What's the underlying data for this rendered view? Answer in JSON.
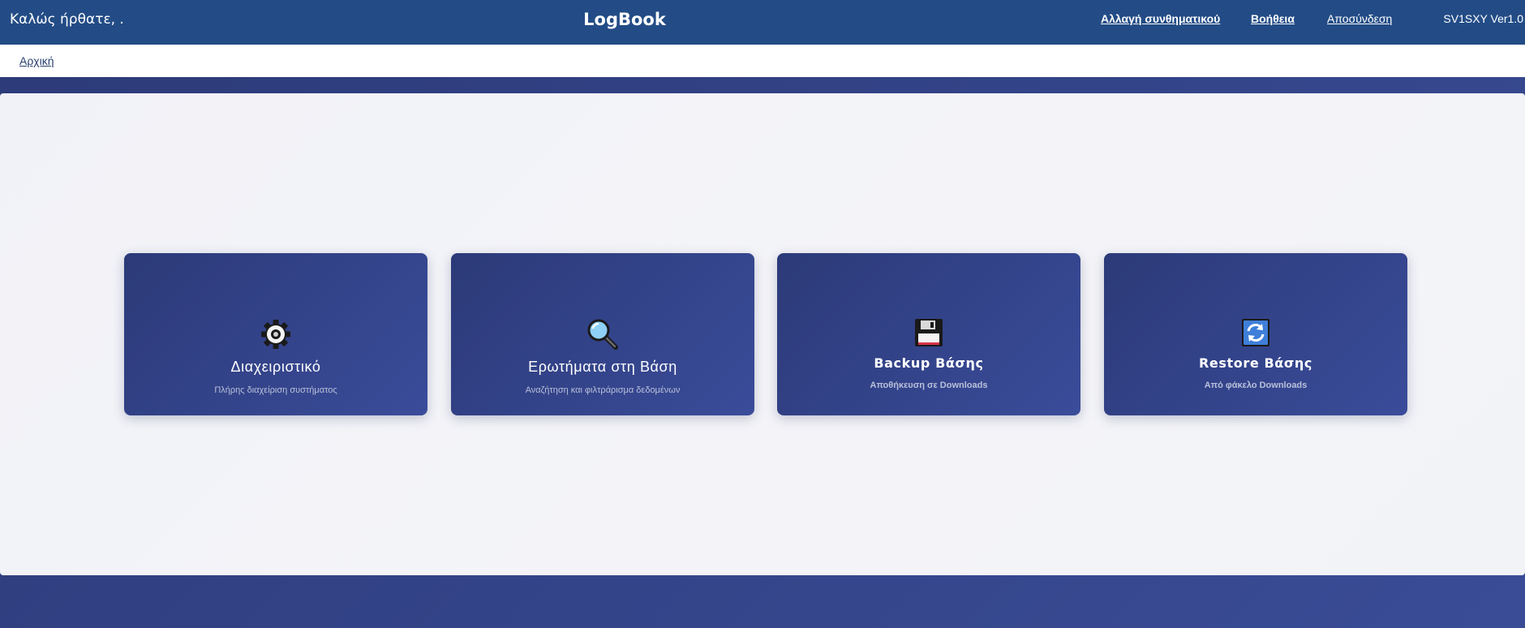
{
  "header": {
    "welcome": "Καλώς ήρθατε, .",
    "app_title": "LogBook",
    "links": {
      "change_password": "Αλλαγή συνθηματικού",
      "help": "Βοήθεια",
      "logout": "Αποσύνδεση"
    },
    "version": "SV1SXY Ver1.0"
  },
  "breadcrumb": {
    "home": "Αρχική"
  },
  "cards": [
    {
      "icon": "gear-icon",
      "title": "Διαχειριστικό",
      "subtitle": "Πλήρης διαχείριση συστήματος"
    },
    {
      "icon": "magnifier-icon",
      "title": "Ερωτήματα στη Βάση",
      "subtitle": "Αναζήτηση και φιλτράρισμα δεδομένων"
    },
    {
      "icon": "floppy-disk-icon",
      "title": "Backup Βάσης",
      "subtitle": "Αποθήκευση σε Downloads"
    },
    {
      "icon": "refresh-icon",
      "title": "Restore Βάσης",
      "subtitle": "Από φάκελο Downloads"
    }
  ],
  "colors": {
    "header_bg": "#234c86",
    "card_bg": "#2f3e80",
    "panel_bg": "#f2f3f7"
  }
}
